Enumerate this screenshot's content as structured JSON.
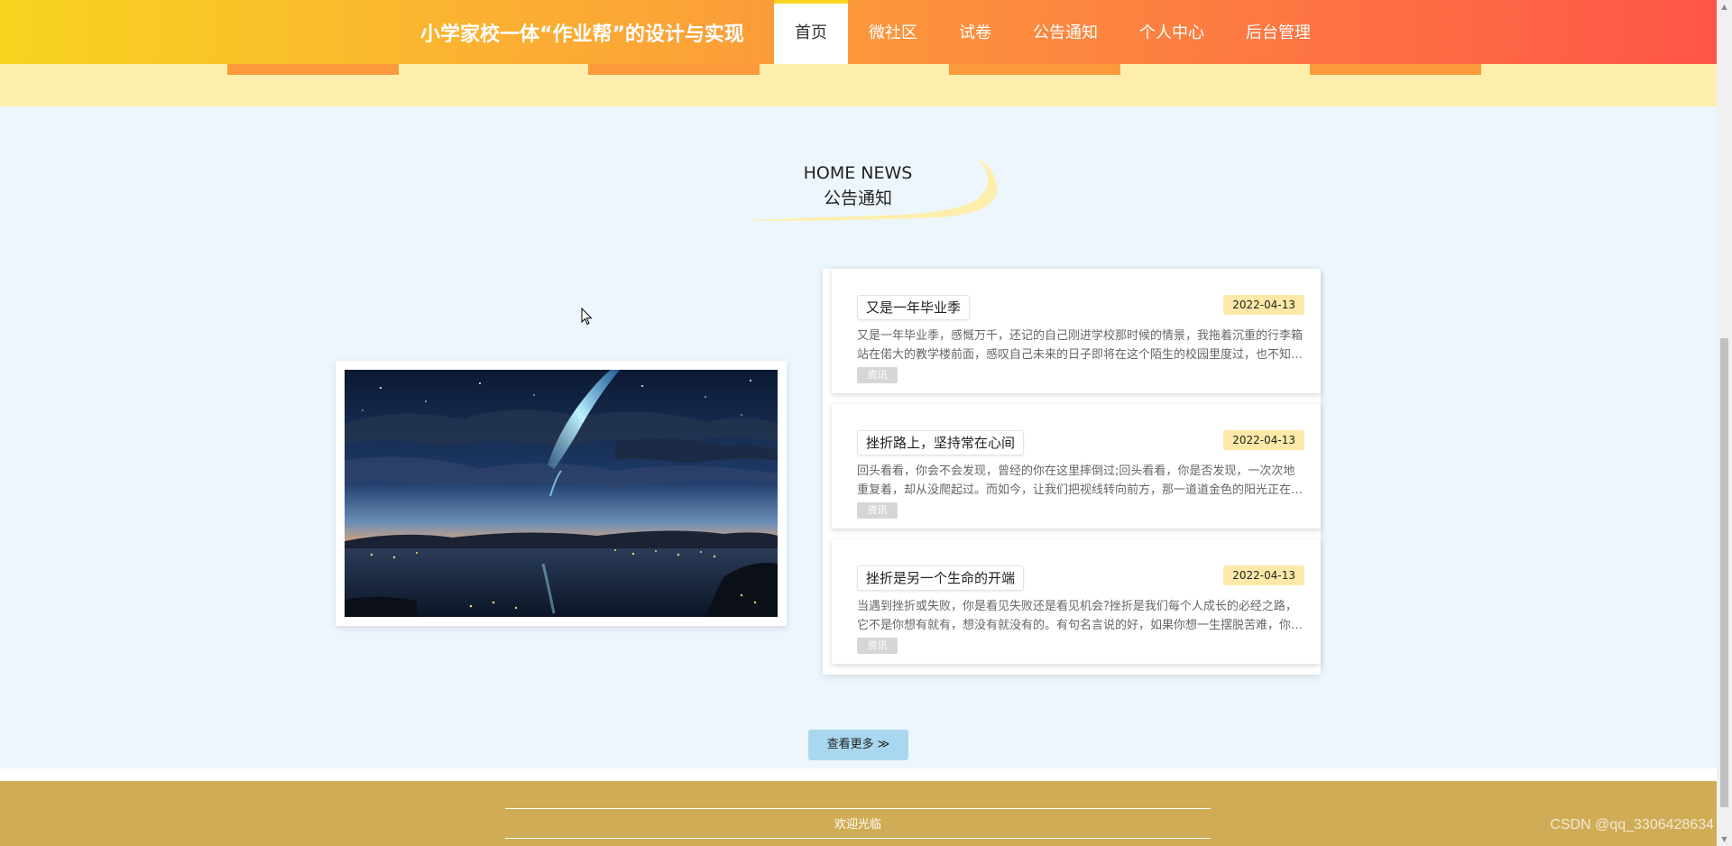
{
  "header": {
    "brand": "小学家校一体“作业帮”的设计与实现",
    "nav": [
      {
        "label": "首页",
        "active": true
      },
      {
        "label": "微社区",
        "active": false
      },
      {
        "label": "试卷",
        "active": false
      },
      {
        "label": "公告通知",
        "active": false
      },
      {
        "label": "个人中心",
        "active": false
      },
      {
        "label": "后台管理",
        "active": false
      }
    ]
  },
  "section": {
    "title_en": "HOME NEWS",
    "title_cn": "公告通知"
  },
  "news": [
    {
      "title": "又是一年毕业季",
      "date": "2022-04-13",
      "desc": "又是一年毕业季，感慨万千，还记的自己刚进学校那时候的情景，我拖着沉重的行李箱站在偌大的教学楼前面，感叹自己未来的日子即将在这个陌生的校园里度过，也不知道未来会是什么样子。",
      "tag": "资讯"
    },
    {
      "title": "挫折路上，坚持常在心间",
      "date": "2022-04-13",
      "desc": "回头看看，你会不会发现，曾经的你在这里摔倒过;回头看看，你是否发现，一次次地重复着，却从没爬起过。而如今，让我们把视线转向前方，那一道道金色的阳光正在向你招手。",
      "tag": "资讯"
    },
    {
      "title": "挫折是另一个生命的开端",
      "date": "2022-04-13",
      "desc": "当遇到挫折或失败，你是看见失败还是看见机会?挫折是我们每个人成长的必经之路，它不是你想有就有，想没有就没有的。有句名言说的好，如果你想一生摆脱苦难，你就得是神或者是死尸。",
      "tag": "资讯"
    }
  ],
  "more_button": "查看更多",
  "footer": {
    "text": "欢迎光临"
  },
  "watermark": "CSDN @qq_3306428634",
  "colors": {
    "header_start": "#f8d41f",
    "header_end": "#ff5548",
    "subbar": "#fdeeac",
    "date_badge": "#fde9a7",
    "more_button": "#a9d7ef",
    "footer": "#d0ac56"
  }
}
